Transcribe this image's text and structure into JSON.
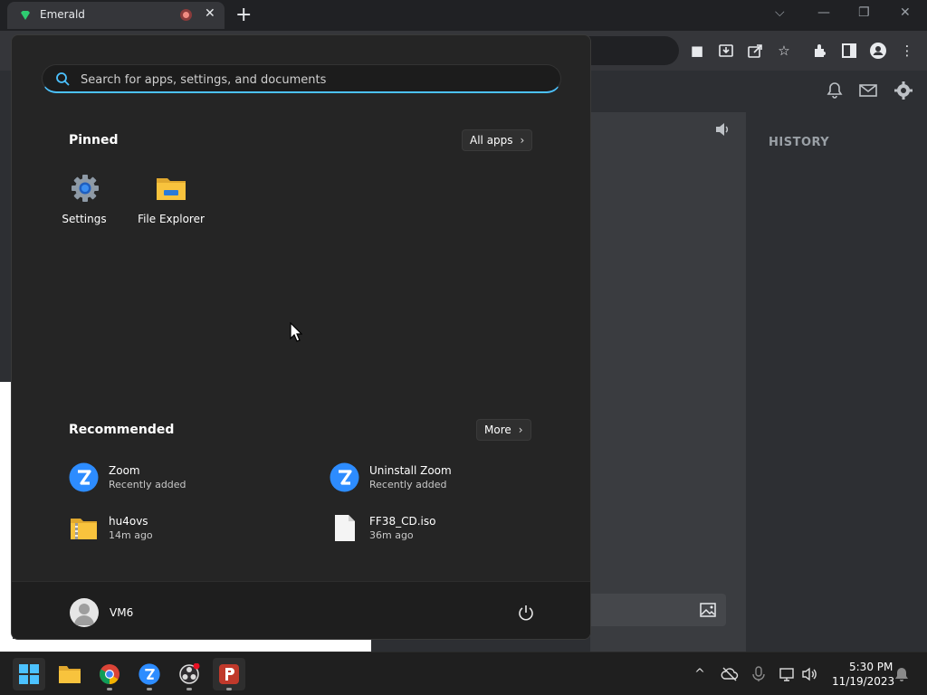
{
  "browser": {
    "tab_title": "Emerald",
    "tab_close": "✕",
    "new_tab": "+",
    "history_label": "HISTORY"
  },
  "start_menu": {
    "search": {
      "placeholder": "Search for apps, settings, and documents"
    },
    "pinned": {
      "title": "Pinned",
      "all_apps_label": "All apps",
      "apps": [
        {
          "label": "Settings",
          "icon": "gear-icon"
        },
        {
          "label": "File Explorer",
          "icon": "folder-icon"
        }
      ]
    },
    "recommended": {
      "title": "Recommended",
      "more_label": "More",
      "items": [
        {
          "name": "Zoom",
          "sub": "Recently added",
          "icon": "zoom-icon"
        },
        {
          "name": "Uninstall Zoom",
          "sub": "Recently added",
          "icon": "zoom-icon"
        },
        {
          "name": "hu4ovs",
          "sub": "14m ago",
          "icon": "zip-folder-icon"
        },
        {
          "name": "FF38_CD.iso",
          "sub": "36m ago",
          "icon": "file-icon"
        }
      ]
    },
    "user": {
      "name": "VM6"
    }
  },
  "taskbar": {
    "time": "5:30 PM",
    "date": "11/19/2023"
  },
  "colors": {
    "accent": "#4cc2ff",
    "zoom_blue": "#2d8cff",
    "folder_yellow": "#f8c33d",
    "emerald_green": "#2ecc71"
  }
}
